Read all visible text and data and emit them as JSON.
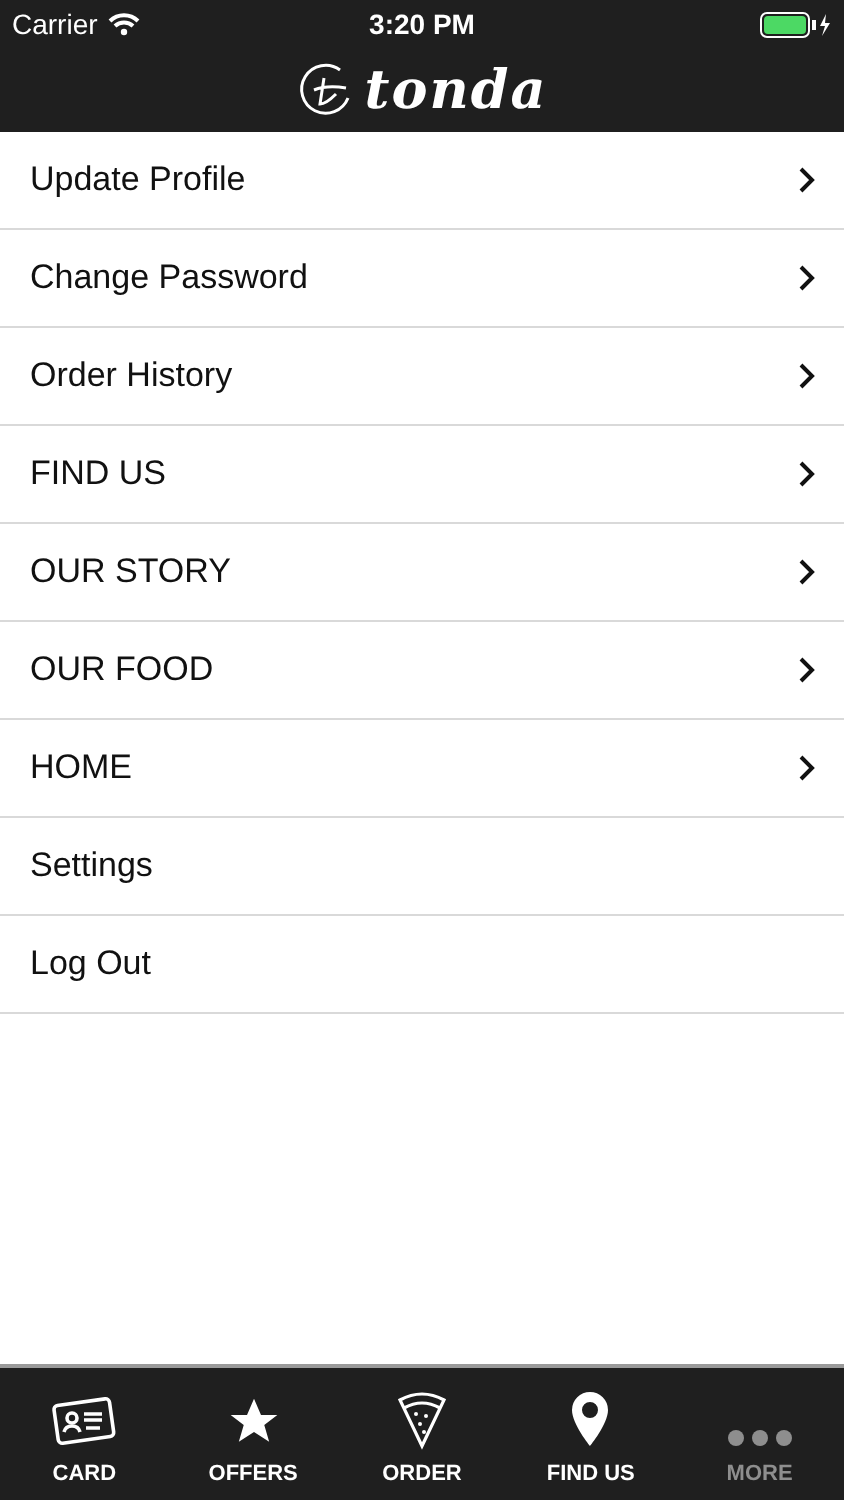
{
  "status_bar": {
    "carrier": "Carrier",
    "time": "3:20 PM"
  },
  "header": {
    "logo": "tonda"
  },
  "menu": [
    {
      "label": "Update Profile",
      "chevron": true
    },
    {
      "label": "Change Password",
      "chevron": true
    },
    {
      "label": "Order History",
      "chevron": true
    },
    {
      "label": "FIND US",
      "chevron": true
    },
    {
      "label": "OUR STORY",
      "chevron": true
    },
    {
      "label": "OUR FOOD",
      "chevron": true
    },
    {
      "label": "HOME",
      "chevron": true
    },
    {
      "label": "Settings",
      "chevron": false
    },
    {
      "label": "Log Out",
      "chevron": false
    }
  ],
  "tabs": [
    {
      "label": "CARD",
      "kind": "card",
      "selected": false
    },
    {
      "label": "OFFERS",
      "kind": "star",
      "selected": false
    },
    {
      "label": "ORDER",
      "kind": "pizza",
      "selected": false
    },
    {
      "label": "FIND US",
      "kind": "pin",
      "selected": false
    },
    {
      "label": "MORE",
      "kind": "more",
      "selected": true
    }
  ]
}
